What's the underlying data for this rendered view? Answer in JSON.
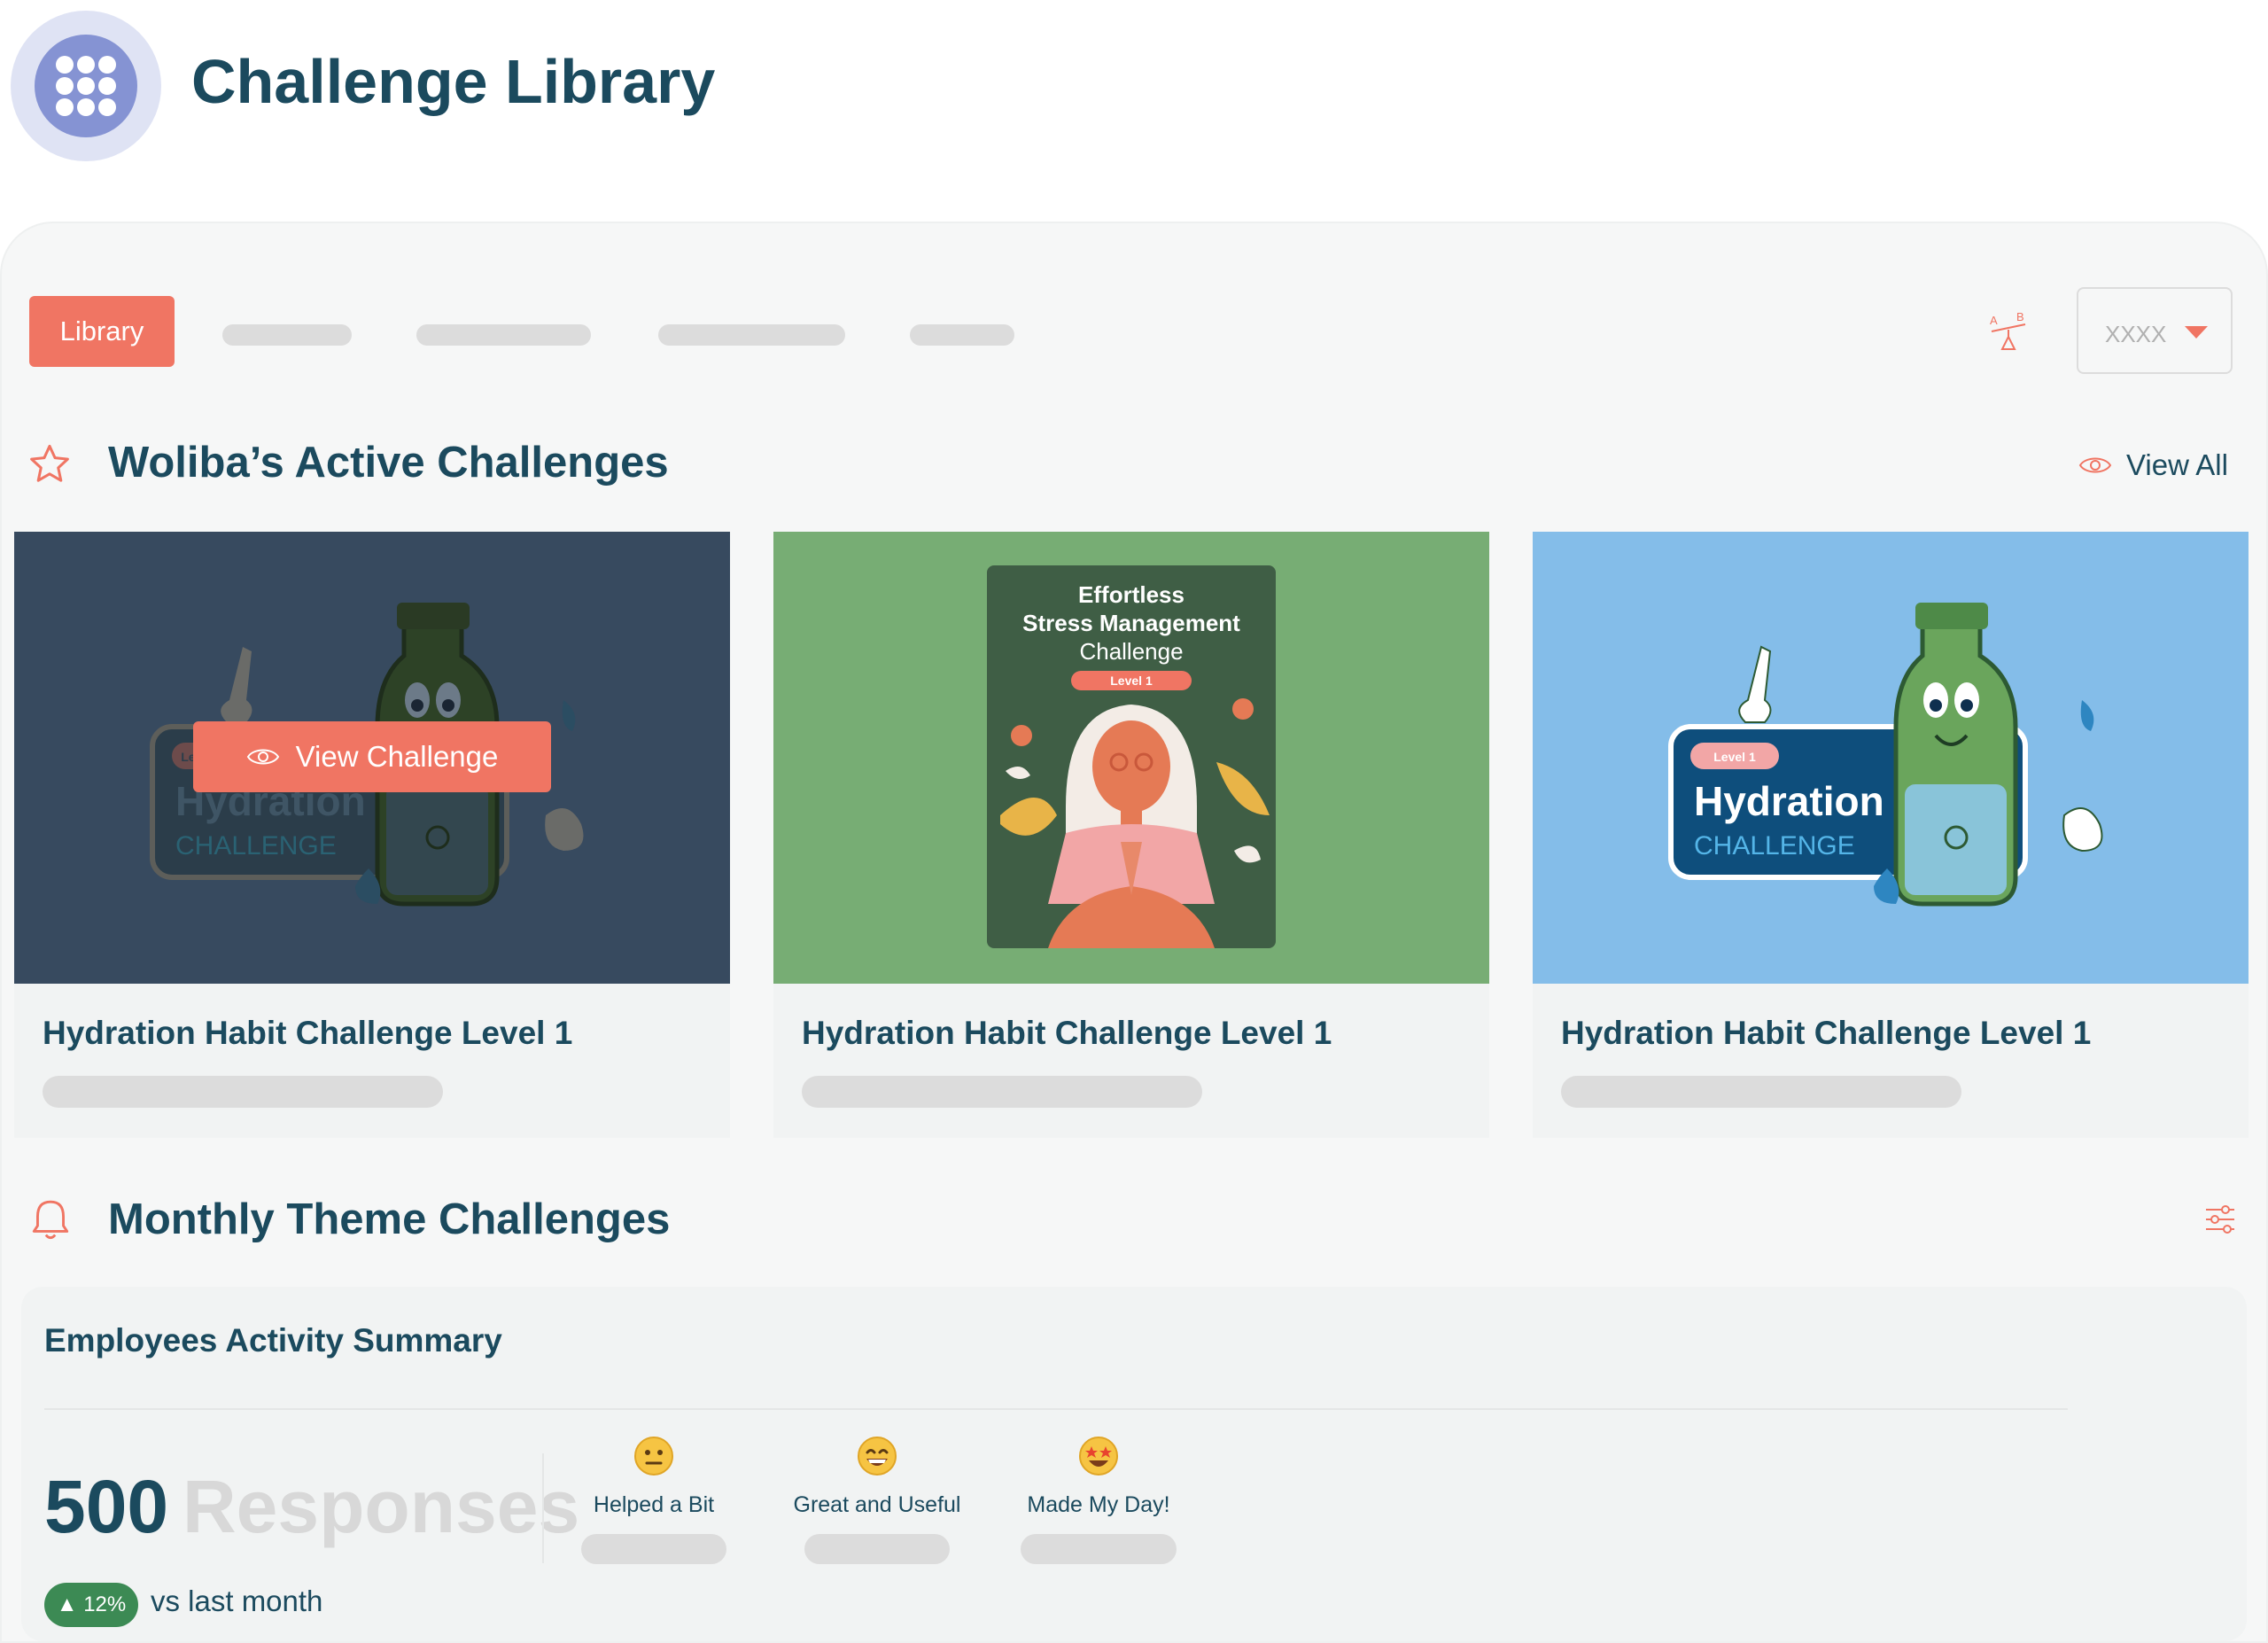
{
  "header": {
    "title": "Challenge Library",
    "icon": "grid-dots-icon"
  },
  "tabs": {
    "active_label": "Library",
    "sort_icon": "ab-sort-icon",
    "dropdown_value": "XXXX"
  },
  "active_section": {
    "title": "Woliba’s Active Challenges",
    "icon": "star-icon",
    "view_all_label": "View All"
  },
  "cards": [
    {
      "title": "Hydration Habit Challenge Level 1",
      "hover_button": "View Challenge",
      "image_bg": "#374a5f",
      "art": {
        "level": "Level 1",
        "name": "Hydration",
        "sub": "CHALLENGE"
      }
    },
    {
      "title": "Hydration Habit Challenge Level 1",
      "image_bg": "#77ad74",
      "art": {
        "line1": "Effortless",
        "line2": "Stress Management",
        "line3": "Challenge",
        "level": "Level 1"
      }
    },
    {
      "title": "Hydration Habit Challenge Level 1",
      "image_bg": "#84bde9",
      "art": {
        "level": "Level 1",
        "name": "Hydration",
        "sub": "CHALLENGE"
      }
    }
  ],
  "monthly_section": {
    "title": "Monthly Theme Challenges",
    "icon": "bell-icon",
    "filter_icon": "sliders-icon"
  },
  "summary": {
    "title": "Employees Activity Summary",
    "responses_count": "500",
    "responses_label": "Responses",
    "change_badge": "▲ 12%",
    "change_label": "vs last month",
    "feedback": [
      {
        "label": "Helped a Bit",
        "emoji": "neutral-face-emoji"
      },
      {
        "label": "Great and Useful",
        "emoji": "grinning-face-emoji"
      },
      {
        "label": "Made My Day!",
        "emoji": "star-struck-emoji"
      }
    ]
  },
  "colors": {
    "accent": "#f07563",
    "heading": "#1b4a5e",
    "placeholder": "#dcdcdc",
    "positive": "#3c8a54"
  }
}
